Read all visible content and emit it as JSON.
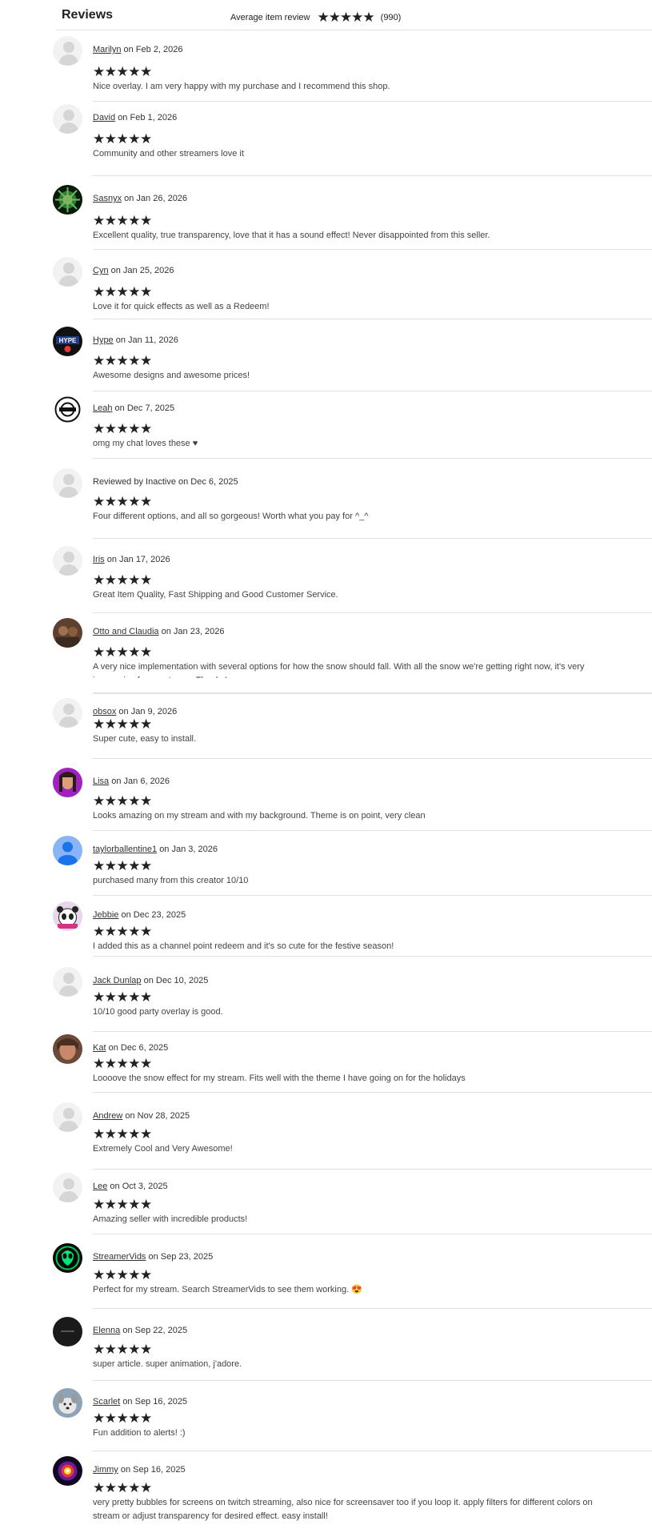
{
  "header": {
    "title": "Reviews",
    "average_label": "Average item review",
    "average_stars": "★★★★★",
    "review_count": "(990)"
  },
  "stars": "★★★★★",
  "reviews": [
    {
      "name": "Marilyn",
      "date": "on Feb 2, 2026",
      "text": "Nice overlay. I am very happy with my purchase and I recommend this shop.",
      "avatar": "default"
    },
    {
      "name": "David",
      "date": "on Feb 1, 2026",
      "text": "Community and other streamers love it",
      "avatar": "default"
    },
    {
      "name": "Sasnyx",
      "date": "on Jan 26, 2026",
      "text": "Excellent quality, true transparency, love that it has a sound effect! Never disappointed from this seller.",
      "avatar": "green-burst"
    },
    {
      "name": "Cyn",
      "date": "on Jan 25, 2026",
      "text": "Love it for quick effects as well as a Redeem!",
      "avatar": "default"
    },
    {
      "name": "Hype",
      "date": "on Jan 11, 2026",
      "text": "Awesome designs and awesome prices!",
      "avatar": "hype-logo"
    },
    {
      "name": "Leah",
      "date": "on Dec 7, 2025",
      "text": "omg my chat loves these ♥",
      "avatar": "bw-emblem"
    },
    {
      "name": "",
      "date": "Reviewed by Inactive on Dec 6, 2025",
      "text": "Four different options, and all so gorgeous! Worth what you pay for ^_^",
      "avatar": "default"
    },
    {
      "name": "Iris",
      "date": "on Jan 17, 2026",
      "text": "Great Item Quality, Fast Shipping and Good Customer Service.",
      "avatar": "default"
    },
    {
      "name": "Otto and Claudia",
      "date": "on Jan 23, 2026",
      "text": "A very nice implementation with several options for how the snow should fall. With all the snow we're getting right now, it's very impressive for my stream. Thanks!",
      "avatar": "brown-photo"
    },
    {
      "name": "obsox",
      "date": "on Jan 9, 2026",
      "text": "Super cute, easy to install.",
      "avatar": "default"
    },
    {
      "name": "Lisa",
      "date": "on Jan 6, 2026",
      "text": "Looks amazing on my stream and with my background. Theme is on point, very clean",
      "avatar": "purple-photo"
    },
    {
      "name": "taylorballentine1",
      "date": "on Jan 3, 2026",
      "text": "purchased many from this creator 10/10",
      "avatar": "blue-person"
    },
    {
      "name": "Jebbie",
      "date": "on Dec 23, 2025",
      "text": "I added this as a channel point redeem and it's so cute for the festive season!",
      "avatar": "panda"
    },
    {
      "name": "Jack Dunlap",
      "date": "on Dec 10, 2025",
      "text": "10/10 good party overlay is good.",
      "avatar": "default"
    },
    {
      "name": "Kat",
      "date": "on Dec 6, 2025",
      "text": "Loooove the snow effect for my stream. Fits well with the theme I have going on for the holidays",
      "avatar": "face-photo"
    },
    {
      "name": "Andrew",
      "date": "on Nov 28, 2025",
      "text": "Extremely Cool and Very Awesome!",
      "avatar": "default"
    },
    {
      "name": "Lee",
      "date": "on Oct 3, 2025",
      "text": "Amazing seller with incredible products!",
      "avatar": "default"
    },
    {
      "name": "StreamerVids",
      "date": "on Sep 23, 2025",
      "text": "Perfect for my stream. Search StreamerVids to see them working. 😍",
      "avatar": "green-alien"
    },
    {
      "name": "Elenna",
      "date": "on Sep 22, 2025",
      "text": "super article. super animation, j'adore.",
      "avatar": "dark-circle"
    },
    {
      "name": "Scarlet",
      "date": "on Sep 16, 2025",
      "text": "Fun addition to alerts! :)",
      "avatar": "grey-dog"
    },
    {
      "name": "Jimmy",
      "date": "on Sep 16, 2025",
      "text": "very pretty bubbles for screens on twitch streaming, also nice for screensaver too if you loop it. apply filters for different colors on stream or adjust transparency for desired effect. easy install!",
      "avatar": "rainbow"
    }
  ]
}
